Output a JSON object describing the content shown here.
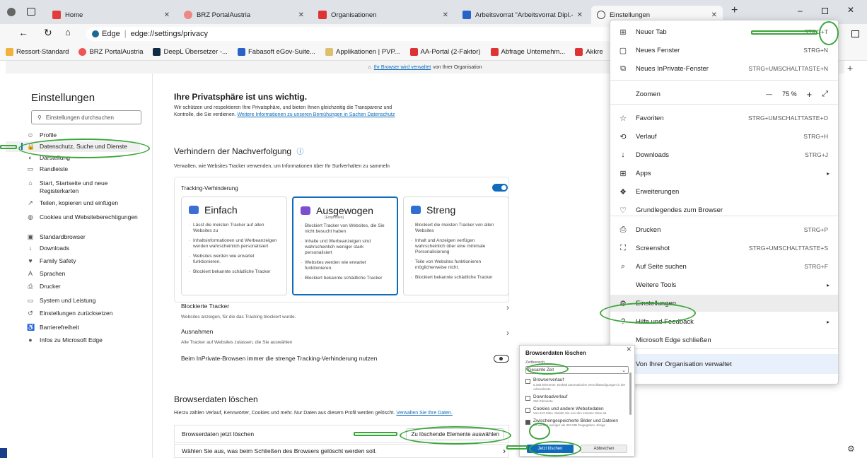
{
  "tabs": [
    {
      "label": "Home"
    },
    {
      "label": "BRZ PortalAustria"
    },
    {
      "label": "Organisationen"
    },
    {
      "label": "Arbeitsvorrat \"Arbeitsvorrat Dipl.-"
    },
    {
      "label": "Einstellungen"
    }
  ],
  "address": {
    "prefix": "Edge",
    "url": "edge://settings/privacy"
  },
  "favorites": [
    "Ressort-Standard",
    "BRZ PortalAustria",
    "DeepL Übersetzer -...",
    "Fabasoft eGov-Suite...",
    "Applikationen | PVP...",
    "AA-Portal (2-Faktor)",
    "Abfrage Unternehm...",
    "Akkre"
  ],
  "managed_banner": {
    "link": "Ihr Browser wird verwaltet",
    "rest": "von Ihrer Organisation"
  },
  "sidebar": {
    "title": "Einstellungen",
    "search_placeholder": "Einstellungen durchsuchen",
    "items": [
      {
        "label": "Profile",
        "icon": "profile-icon"
      },
      {
        "label": "Datenschutz, Suche und Dienste",
        "icon": "lock-icon"
      },
      {
        "label": "Darstellung",
        "icon": "appearance-icon"
      },
      {
        "label": "Randleiste",
        "icon": "sidebar-icon"
      },
      {
        "label": "Start, Startseite und neue Registerkarten",
        "icon": "home-icon"
      },
      {
        "label": "Teilen, kopieren und einfügen",
        "icon": "share-icon"
      },
      {
        "label": "Cookies und Websiteberechtigungen",
        "icon": "cookie-icon"
      },
      {
        "label": "Standardbrowser",
        "icon": "browser-icon"
      },
      {
        "label": "Downloads",
        "icon": "download-icon"
      },
      {
        "label": "Family Safety",
        "icon": "family-icon"
      },
      {
        "label": "Sprachen",
        "icon": "language-icon"
      },
      {
        "label": "Drucker",
        "icon": "printer-icon"
      },
      {
        "label": "System und Leistung",
        "icon": "system-icon"
      },
      {
        "label": "Einstellungen zurücksetzen",
        "icon": "reset-icon"
      },
      {
        "label": "Barrierefreiheit",
        "icon": "accessibility-icon"
      },
      {
        "label": "Infos zu Microsoft Edge",
        "icon": "edge-icon"
      }
    ]
  },
  "main": {
    "privacy_title": "Ihre Privatsphäre ist uns wichtig.",
    "privacy_text": "Wir schützen und respektieren Ihre Privatsphäre, und bieten Ihnen gleichzeitig die Transparenz und Kontrolle, die Sie verdienen.",
    "privacy_link": "Weitere Informationen zu unseren Bemühungen in Sachen Datenschutz",
    "tracking_title": "Verhindern der Nachverfolgung",
    "tracking_desc": "Verwalten, wie Websites Tracker verwenden, um Informationen über Ihr Surfverhalten zu sammeln",
    "tracking_box_label": "Tracking-Verhinderung",
    "cards": [
      {
        "title": "Einfach",
        "subtitle": "",
        "bullets": [
          "Lässt die meisten Tracker auf allen Websites zu",
          "Inhaltsinformationen und Werbeanzeigen werden wahrscheinlich personalisiert",
          "Websites werden wie erwartet funktionieren.",
          "Blockiert bekannte schädliche Tracker"
        ]
      },
      {
        "title": "Ausgewogen",
        "subtitle": "(Empfohlen)",
        "bullets": [
          "Blockiert Tracker von Websites, die Sie nicht besucht haben",
          "Inhalte und Werbeanzeigen sind wahrscheinlich weniger stark personalisiert",
          "Websites werden wie erwartet funktionieren.",
          "Blockiert bekannte schädliche Tracker"
        ]
      },
      {
        "title": "Streng",
        "subtitle": "",
        "bullets": [
          "Blockiert die meisten Tracker von allen Websites",
          "Inhalt und Anzeigen verfügen wahrscheinlich über eine minimale Personalisierung",
          "Teile von Websites funktionieren möglicherweise nicht.",
          "Blockiert bekannte schädliche Tracker"
        ]
      }
    ],
    "blocked_title": "Blockierte Tracker",
    "blocked_desc": "Websites anzeigen, für die das Tracking blockiert wurde.",
    "exceptions_title": "Ausnahmen",
    "exceptions_desc": "Alle Tracker auf Websites zulassen, die Sie auswählen",
    "inprivate_label": "Beim InPrivate-Browsen immer die strenge Tracking-Verhinderung nutzen",
    "clear_title": "Browserdaten löschen",
    "clear_desc": "Hierzu zählen Verlauf, Kennwörter, Cookies und mehr. Nur Daten aus diesem Profil werden gelöscht.",
    "clear_link": "Verwalten Sie Ihre Daten.",
    "clear_now_label": "Browserdaten jetzt löschen",
    "clear_button": "Zu löschende Elemente auswählen",
    "on_close_label": "Wählen Sie aus, was beim Schließen des Browsers gelöscht werden soll."
  },
  "menu": {
    "items": [
      {
        "label": "Neuer Tab",
        "shortcut": "STRG+T",
        "icon": "new-tab-icon"
      },
      {
        "label": "Neues Fenster",
        "shortcut": "STRG+N",
        "icon": "new-window-icon"
      },
      {
        "label": "Neues InPrivate-Fenster",
        "shortcut": "STRG+UMSCHALTTASTE+N",
        "icon": "inprivate-icon"
      },
      {
        "label": "Zoomen",
        "zoom": "75 %"
      },
      {
        "label": "Favoriten",
        "shortcut": "STRG+UMSCHALTTASTE+O",
        "icon": "favorites-icon"
      },
      {
        "label": "Verlauf",
        "shortcut": "STRG+H",
        "icon": "history-icon"
      },
      {
        "label": "Downloads",
        "shortcut": "STRG+J",
        "icon": "download-icon"
      },
      {
        "label": "Apps",
        "icon": "apps-icon"
      },
      {
        "label": "Erweiterungen",
        "icon": "extensions-icon"
      },
      {
        "label": "Grundlegendes zum Browser",
        "icon": "heart-icon"
      },
      {
        "label": "Drucken",
        "shortcut": "STRG+P",
        "icon": "print-icon"
      },
      {
        "label": "Screenshot",
        "shortcut": "STRG+UMSCHALTTASTE+S",
        "icon": "screenshot-icon"
      },
      {
        "label": "Auf Seite suchen",
        "shortcut": "STRG+F",
        "icon": "find-icon"
      },
      {
        "label": "Weitere Tools"
      },
      {
        "label": "Einstellungen",
        "icon": "gear-icon"
      },
      {
        "label": "Hilfe und Feedback",
        "icon": "help-icon"
      },
      {
        "label": "Microsoft Edge schließen"
      },
      {
        "label": "Von Ihrer Organisation verwaltet",
        "icon": "managed-icon"
      }
    ]
  },
  "popup": {
    "title": "Browserdaten löschen",
    "range_label": "Zeitbereich",
    "range_value": "Gesamte Zeit",
    "options": [
      {
        "label": "Browserverlauf",
        "detail": "5.358 Elemente. Enthält automatische Vervollständigungen in der Adressleiste.",
        "checked": false
      },
      {
        "label": "Downloadverlauf",
        "detail": "262 Elemente",
        "checked": false
      },
      {
        "label": "Cookies und andere Websitedaten",
        "detail": "Von 313 Sites. Meldet Sie von den meisten Sites ab.",
        "checked": false
      },
      {
        "label": "Zwischengespeicherte Bilder und Dateien",
        "detail": "Es werden weniger als 320 MB freigegeben. Einige",
        "checked": true
      }
    ],
    "confirm": "Jetzt löschen",
    "cancel": "Abbrechen"
  }
}
